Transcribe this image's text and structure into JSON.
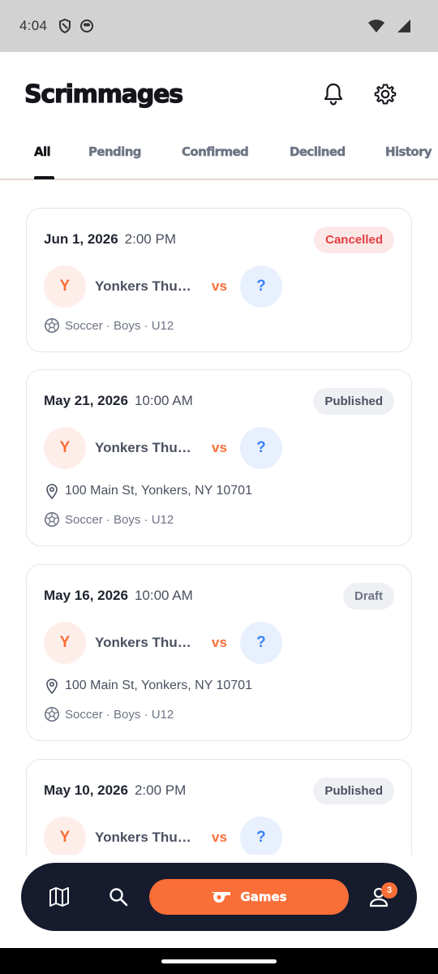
{
  "status_bar": {
    "time": "4:04",
    "icons": [
      "shield-icon",
      "face-icon"
    ],
    "right_icons": [
      "wifi-icon",
      "signal-icon"
    ]
  },
  "header": {
    "title": "Scrimmages",
    "actions": [
      "bell-icon",
      "gear-icon"
    ]
  },
  "tabs": [
    {
      "label": "All",
      "active": true
    },
    {
      "label": "Pending"
    },
    {
      "label": "Confirmed"
    },
    {
      "label": "Declined"
    },
    {
      "label": "History"
    }
  ],
  "cards": [
    {
      "date": "Jun 1, 2026",
      "time": "2:00 PM",
      "status": "Cancelled",
      "home_initial": "Y",
      "home_team": "Yonkers Thu…",
      "vs": "vs",
      "away_initial": "?",
      "details": "Soccer · Boys · U12"
    },
    {
      "date": "May 21, 2026",
      "time": "10:00 AM",
      "status": "Published",
      "home_initial": "Y",
      "home_team": "Yonkers Thu…",
      "vs": "vs",
      "away_initial": "?",
      "address": "100 Main St, Yonkers, NY 10701",
      "details": "Soccer · Boys · U12"
    },
    {
      "date": "May 16, 2026",
      "time": "10:00 AM",
      "status": "Draft",
      "home_initial": "Y",
      "home_team": "Yonkers Thu…",
      "vs": "vs",
      "away_initial": "?",
      "address": "100 Main St, Yonkers, NY 10701",
      "details": "Soccer · Boys · U12"
    },
    {
      "date": "May 10, 2026",
      "time": "2:00 PM",
      "status": "Published",
      "home_initial": "Y",
      "home_team": "Yonkers Thu…",
      "vs": "vs",
      "away_initial": "?"
    }
  ],
  "bottom_nav": {
    "items": [
      "map-icon",
      "search-icon",
      "whistle-icon",
      "profile-icon"
    ],
    "games_label": "Games",
    "profile_badge": "3"
  },
  "colors": {
    "accent": "#fa6e37",
    "nav_bg": "#161b2e",
    "cancelled": "#e2403f",
    "away_blue": "#3b82f6"
  }
}
